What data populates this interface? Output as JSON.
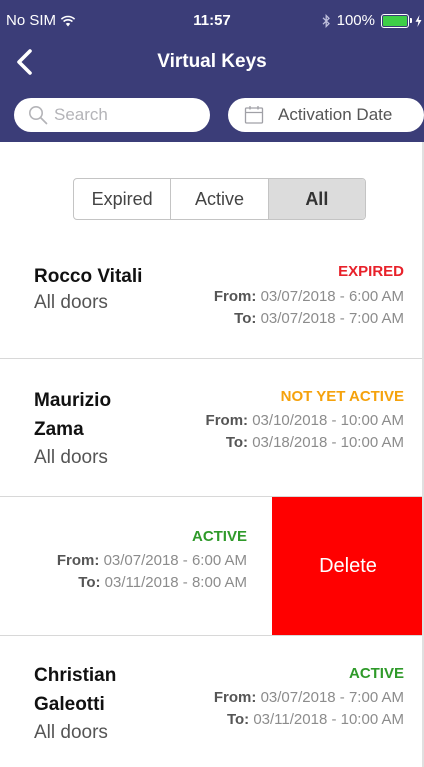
{
  "status_bar": {
    "carrier": "No SIM",
    "time": "11:57",
    "battery_text": "100%",
    "battery_level": 1.0,
    "icons": [
      "wifi-icon",
      "bluetooth-icon",
      "battery-icon",
      "charging-icon"
    ]
  },
  "nav": {
    "title": "Virtual Keys",
    "back_icon": "chevron-left-icon"
  },
  "search": {
    "placeholder": "Search",
    "value": "",
    "icon": "search-icon"
  },
  "date_filter": {
    "label": "Activation Date",
    "icon": "calendar-icon"
  },
  "filter_segment": {
    "options": [
      "Expired",
      "Active",
      "All"
    ],
    "selected": "All"
  },
  "keys": [
    {
      "name": "Rocco Vitali",
      "doors": "All doors",
      "status": "EXPIRED",
      "from_label": "From:",
      "from": "03/07/2018 - 6:00 AM",
      "to_label": "To:",
      "to": "03/07/2018 - 7:00 AM"
    },
    {
      "name": "Maurizio Zama",
      "doors": "All doors",
      "status": "NOT YET ACTIVE",
      "from_label": "From:",
      "from": "03/10/2018 - 10:00 AM",
      "to_label": "To:",
      "to": "03/18/2018 - 10:00 AM"
    },
    {
      "status": "ACTIVE",
      "from_label": "From:",
      "from": "03/07/2018 - 6:00 AM",
      "to_label": "To:",
      "to": "03/11/2018 - 8:00 AM",
      "delete_label": "Delete"
    },
    {
      "name": "Christian Galeotti",
      "doors": "All doors",
      "status": "ACTIVE",
      "from_label": "From:",
      "from": "03/07/2018 - 7:00 AM",
      "to_label": "To:",
      "to": "03/11/2018 - 10:00 AM"
    }
  ],
  "colors": {
    "header": "#3b3d78",
    "expired": "#e8212a",
    "not_yet_active": "#f5a20c",
    "active": "#2f9a2a",
    "delete": "#ff0000"
  }
}
